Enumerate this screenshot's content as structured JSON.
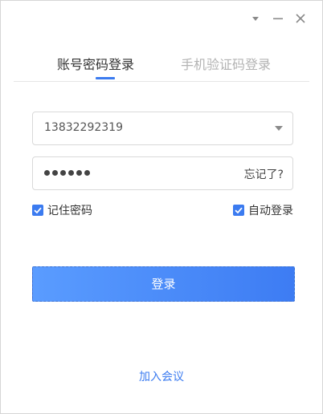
{
  "window": {
    "controls": [
      "menu-dropdown-icon",
      "minimize-icon",
      "close-icon"
    ]
  },
  "tabs": [
    {
      "label": "账号密码登录",
      "active": true
    },
    {
      "label": "手机验证码登录",
      "active": false
    }
  ],
  "account_field": {
    "value": "13832292319"
  },
  "password_field": {
    "masked_length": 6,
    "forgot_label": "忘记了?"
  },
  "options": {
    "remember_password": {
      "label": "记住密码",
      "checked": true
    },
    "auto_login": {
      "label": "自动登录",
      "checked": true
    }
  },
  "login_button": {
    "label": "登录"
  },
  "join_meeting": {
    "label": "加入会议"
  },
  "colors": {
    "accent": "#3b7bf0",
    "button_start": "#5a9cff",
    "button_end": "#3d7cf3",
    "inactive_tab": "#b3b3b3"
  }
}
